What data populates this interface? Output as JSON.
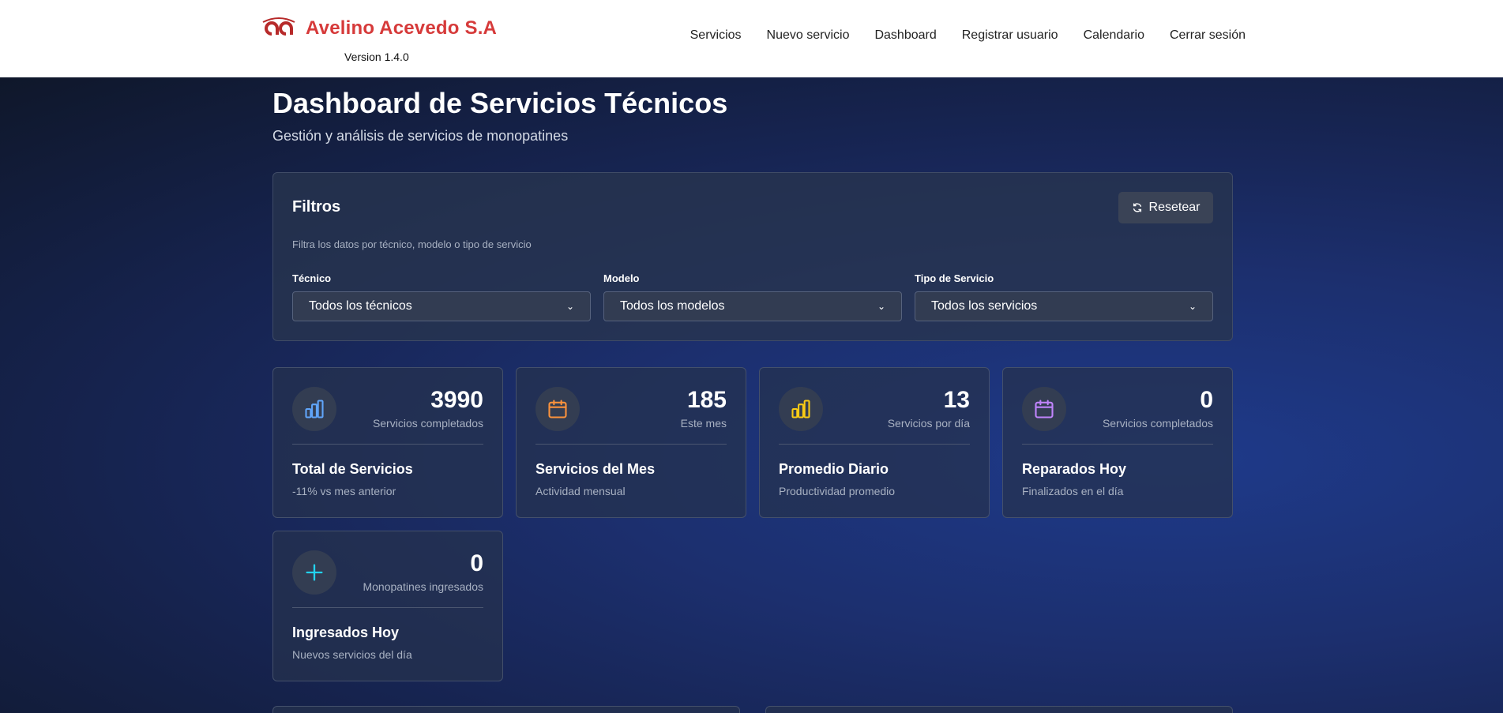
{
  "header": {
    "brand_name": "Avelino Acevedo S.A",
    "version": "Version 1.4.0",
    "brand_color": "#d63a3a",
    "nav": [
      {
        "label": "Servicios"
      },
      {
        "label": "Nuevo servicio"
      },
      {
        "label": "Dashboard"
      },
      {
        "label": "Registrar usuario"
      },
      {
        "label": "Calendario"
      },
      {
        "label": "Cerrar sesión"
      }
    ]
  },
  "page": {
    "title": "Dashboard de Servicios Técnicos",
    "subtitle": "Gestión y análisis de servicios de monopatines"
  },
  "filters": {
    "title": "Filtros",
    "description": "Filtra los datos por técnico, modelo o tipo de servicio",
    "reset_label": "Resetear",
    "fields": [
      {
        "label": "Técnico",
        "value": "Todos los técnicos"
      },
      {
        "label": "Modelo",
        "value": "Todos los modelos"
      },
      {
        "label": "Tipo de Servicio",
        "value": "Todos los servicios"
      }
    ]
  },
  "stats": [
    {
      "icon": "bar-chart-icon",
      "icon_color": "#60a5fa",
      "value": "3990",
      "value_label": "Servicios completados",
      "title": "Total de Servicios",
      "subtitle": "-11% vs mes anterior"
    },
    {
      "icon": "calendar-icon",
      "icon_color": "#fb923c",
      "value": "185",
      "value_label": "Este mes",
      "title": "Servicios del Mes",
      "subtitle": "Actividad mensual"
    },
    {
      "icon": "bar-chart-icon",
      "icon_color": "#facc15",
      "value": "13",
      "value_label": "Servicios por día",
      "title": "Promedio Diario",
      "subtitle": "Productividad promedio"
    },
    {
      "icon": "calendar-icon",
      "icon_color": "#c084fc",
      "value": "0",
      "value_label": "Servicios completados",
      "title": "Reparados Hoy",
      "subtitle": "Finalizados en el día"
    },
    {
      "icon": "plus-icon",
      "icon_color": "#22d3ee",
      "value": "0",
      "value_label": "Monopatines ingresados",
      "title": "Ingresados Hoy",
      "subtitle": "Nuevos servicios del día"
    }
  ]
}
